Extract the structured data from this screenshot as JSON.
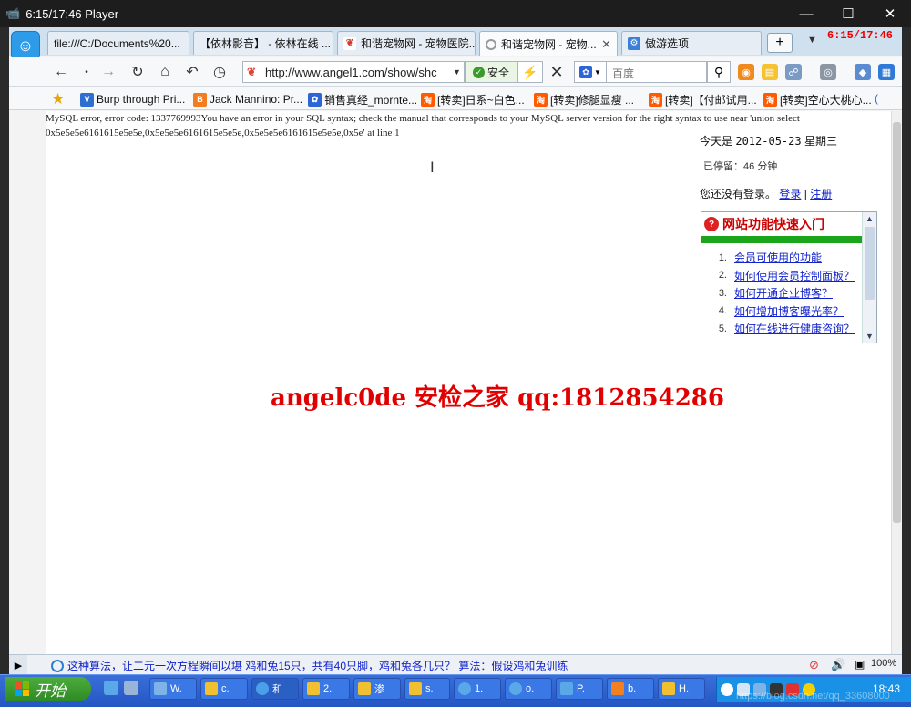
{
  "player": {
    "title": "6:15/17:46 Player",
    "rec_time": "6:15/17:46"
  },
  "tabs": [
    {
      "label": "file:///C:/Documents%20...",
      "icon": "page-icon",
      "color": "#888888"
    },
    {
      "label": "【依林影音】 - 依林在线 ...",
      "icon": "page-icon",
      "color": "#888888"
    },
    {
      "label": "和谐宠物网 - 宠物医院...",
      "icon": "site-icon",
      "color": "#d43a2a"
    },
    {
      "label": "和谐宠物网 - 宠物...",
      "icon": "loading-icon",
      "color": "#888888"
    },
    {
      "label": "傲游选项",
      "icon": "settings-icon",
      "color": "#3b7fd6"
    }
  ],
  "address": {
    "url": "http://www.angel1.com/show/shc",
    "safe_label": "安全"
  },
  "search": {
    "placeholder": "百度"
  },
  "bookmarks": [
    {
      "label": "Burp through Pri...",
      "icon": "v-icon",
      "color": "#2c6fd1",
      "glyph": "V"
    },
    {
      "label": "Jack Mannino: Pr...",
      "icon": "blogger-icon",
      "color": "#f37b20",
      "glyph": "B"
    },
    {
      "label": "销售真经_mornte...",
      "icon": "baidu-icon",
      "color": "#2d64d6",
      "glyph": "✿"
    },
    {
      "label": "[转卖]日系~白色...",
      "icon": "taobao-icon",
      "color": "#ff5a00",
      "glyph": "淘"
    },
    {
      "label": "[转卖]修腿显瘦 ...",
      "icon": "taobao-icon",
      "color": "#ff5a00",
      "glyph": "淘"
    },
    {
      "label": "[转卖]【付邮试用...",
      "icon": "taobao-icon",
      "color": "#ff5a00",
      "glyph": "淘"
    },
    {
      "label": "[转卖]空心大桃心...",
      "icon": "taobao-icon",
      "color": "#ff5a00",
      "glyph": "淘"
    }
  ],
  "page": {
    "sql_error": "MySQL error, error code: 1337769993You have an error in your SQL syntax; check the manual that corresponds to your MySQL server version for the right syntax to use near 'union select 0x5e5e5e6161615e5e5e,0x5e5e5e6161615e5e5e,0x5e5e5e6161615e5e5e,0x5e' at line 1",
    "date_prefix": "今天是",
    "date": "2012-05-23",
    "weekday": "星期三",
    "stay_prefix": "已停留：",
    "stay_minutes": "46",
    "stay_unit": "分钟",
    "login_prompt": "您还没有登录。",
    "login_link": "登录",
    "separator": "|",
    "register_link": "注册",
    "quick_title": "网站功能快速入门",
    "quick_items": [
      {
        "num": "1.",
        "label": "会员可使用的功能"
      },
      {
        "num": "2.",
        "label": "如何使用会员控制面板？"
      },
      {
        "num": "3.",
        "label": "如何开通企业博客？"
      },
      {
        "num": "4.",
        "label": "如何增加博客曝光率？"
      },
      {
        "num": "5.",
        "label": "如何在线进行健康咨询？"
      }
    ],
    "watermark": "angelc0de 安检之家 qq:1812854286"
  },
  "status": {
    "text": "这种算法，让二元一次方程瞬间以堪 鸡和兔15只，共有40只脚，鸡和兔各几只？ 算法：假设鸡和兔训练",
    "zoom": "100%"
  },
  "taskbar": {
    "start_label": "开始",
    "items": [
      {
        "label": "W.",
        "color": "#7fb3e8"
      },
      {
        "label": "c.",
        "color": "#f0c030"
      },
      {
        "label": "和",
        "color": "#4aa0e8"
      },
      {
        "label": "2.",
        "color": "#f0c030"
      },
      {
        "label": "渗",
        "color": "#f0c030"
      },
      {
        "label": "s.",
        "color": "#f0c030"
      },
      {
        "label": "1.",
        "color": "#5aa8e8"
      },
      {
        "label": "o.",
        "color": "#5aa8e8"
      },
      {
        "label": "P.",
        "color": "#5aa8e8"
      },
      {
        "label": "b.",
        "color": "#f08020"
      },
      {
        "label": "H.",
        "color": "#f0c030"
      }
    ],
    "clock": "18:43"
  },
  "overlay": {
    "blog_watermark": "https://blog.csdn.net/qq_33608000"
  }
}
